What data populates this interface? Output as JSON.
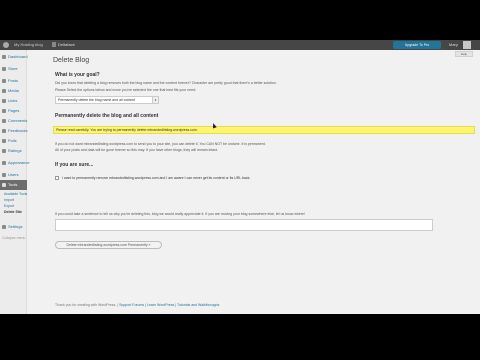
{
  "adminbar": {
    "site_label": "My Hosting blog",
    "site_name": "Deltaface",
    "upgrade_label": "Upgrade To Pro",
    "user_label": "Mary"
  },
  "sidebar": {
    "items": [
      {
        "label": "Dashboard"
      },
      {
        "label": "Store"
      },
      {
        "label": "Posts"
      },
      {
        "label": "Media"
      },
      {
        "label": "Links"
      },
      {
        "label": "Pages"
      },
      {
        "label": "Comments"
      },
      {
        "label": "Feedbacks"
      },
      {
        "label": "Polls"
      },
      {
        "label": "Ratings"
      },
      {
        "label": "Appearance"
      },
      {
        "label": "Users"
      },
      {
        "label": "Tools"
      }
    ],
    "tools_sub": [
      "Available Tools",
      "Import",
      "Export",
      "Delete Site"
    ],
    "settings_label": "Settings",
    "collapse_label": "Collapse menu"
  },
  "main": {
    "title": "Delete Blog",
    "help_label": "Help",
    "goal_heading": "What is your goal?",
    "goal_text": "Did you know that deleting a blog removes both the blog name and the content forever? Character are pretty good that there's a better solution.",
    "goal_select_prompt": "Please Select the options below and move you've selected the one that best fits your need:",
    "select_value": "Permanently delete the blog name and all content",
    "perm_heading": "Permanently delete the blog and all content",
    "warning_text": "Please read carefully. You are trying to permanently delete mbrandedlisting.wordpress.com.",
    "info_line1": "If you do not want mbrandedlisting.wordpress.com to send you to your site, you can delete it. You CAN NOT be undone. It is permanent.",
    "info_line2": "All of your posts and data will be gone forever so this may. If you have other blogs, they will remain intact.",
    "sure_heading": "If you are sure...",
    "checkbox_text": "I want to permanently remove mbrandedlisting.wordpress.com and I am aware I can never get its content or its URL back.",
    "sentence_prompt": "If you could take a sentence to tell us why you're deleting this, blog we would really appreciate it. If you are moving your blog somewhere else, let us know where!",
    "button_label": "Delete mbrandedlisting.wordpress.com Permanently »",
    "footer_thanks": "Thank you for creating with WordPress. | ",
    "footer_links": "Support Forums | Learn WordPress | Tutorials and Walkthroughs"
  }
}
